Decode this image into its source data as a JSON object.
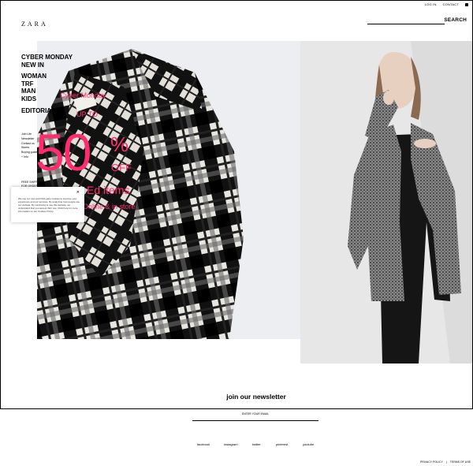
{
  "header": {
    "logo": "ZARA",
    "top_links": [
      "LOG IN",
      "CONTACT"
    ],
    "search_label": "SEARCH"
  },
  "nav": {
    "primary": [
      "CYBER MONDAY",
      "NEW IN"
    ],
    "sections": [
      "WOMAN",
      "TRF",
      "MAN",
      "KIDS"
    ],
    "editorial": "EDITORIAL"
  },
  "small_links": [
    "Join Life",
    "Newsletter",
    "Contact us",
    "Stores",
    "Buying guide",
    "+ Info"
  ],
  "free_shipping": [
    "FREE SHIPPING",
    "FOR ORDERS"
  ],
  "promo": {
    "line1": "Cyber Monday",
    "line2": "UP TO",
    "big_number": "50",
    "percent": "%",
    "off": "OFF",
    "line3": "Ed items",
    "line4": "Online & in store",
    "accent_color": "#ff2d6f"
  },
  "cookie": {
    "text": "We use our own and third-party cookies to improve your experience and our services. By analyzing how people use our website. By continuing to use this website, we understand that you accept their use. Click here for more information on our Cookies Policy.",
    "close_icon": "close-icon"
  },
  "newsletter": {
    "title": "join our newsletter",
    "email_placeholder": "ENTER YOUR EMAIL"
  },
  "social": [
    "facebook",
    "instagram",
    "twitter",
    "pinterest",
    "youtube"
  ],
  "footer": {
    "privacy": "PRIVACY POLICY",
    "separator": "|",
    "terms": "TERMS OF USE"
  }
}
